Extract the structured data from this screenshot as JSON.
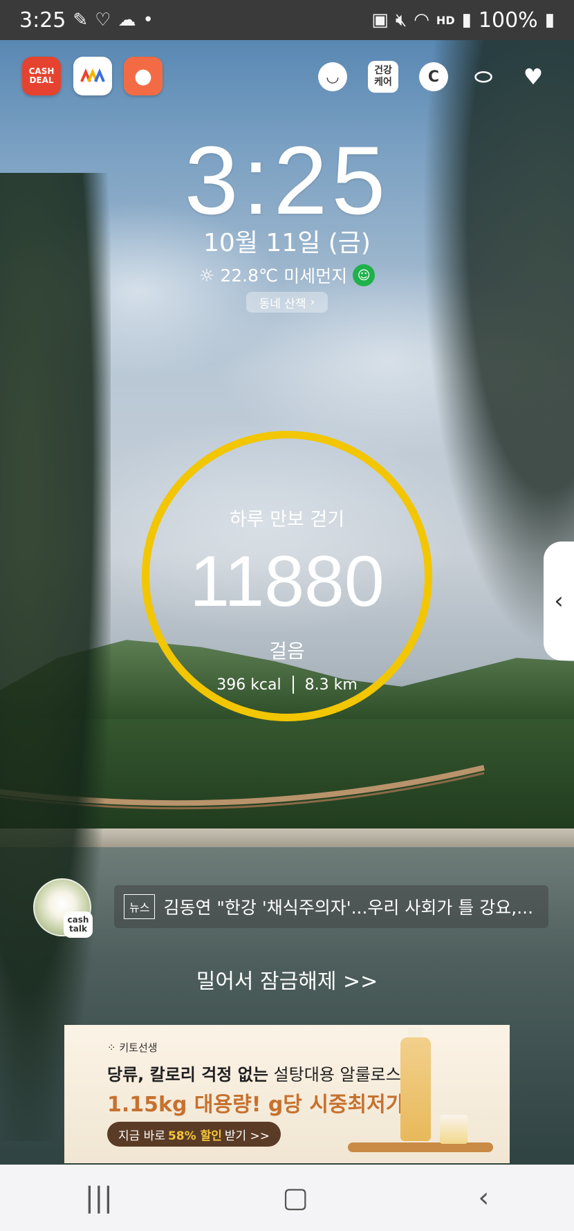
{
  "status_bar": {
    "time": "3:25",
    "battery": "100%",
    "hd_voice": "HD"
  },
  "top_apps": {
    "cash_deal": "CASH DEAL",
    "health_care": [
      "건강",
      "케어"
    ]
  },
  "lock": {
    "time": "3:25",
    "date": "10월 11일 (금)",
    "temperature": "22.8℃",
    "dust_label": "미세먼지",
    "walk_button": "동네 산책"
  },
  "steps_widget": {
    "title": "하루 만보 걷기",
    "steps": "11880",
    "unit": "걸음",
    "kcal": "396 kcal",
    "distance": "8.3 km",
    "ring_color": "#f2c600"
  },
  "news": {
    "tag": "뉴스",
    "headline": "김동연 \"한강 '채식주의자'...우리 사회가 틀 강요,..."
  },
  "cashtalk": "cash talk",
  "unlock_hint": "밀어서 잠금해제 >>",
  "ad": {
    "brand": "키토선생",
    "line1_bold": "당류, 칼로리 걱정 없는",
    "line1_rest": " 설탕대용 알룰로스!",
    "line2": "1.15kg 대용량! g당 시중최저가!",
    "cta_prefix": "지금 바로 ",
    "cta_highlight": "58% 할인",
    "cta_suffix": " 받기 >>"
  },
  "nav": {
    "recents": "|||",
    "home": "▢",
    "back": "‹"
  }
}
